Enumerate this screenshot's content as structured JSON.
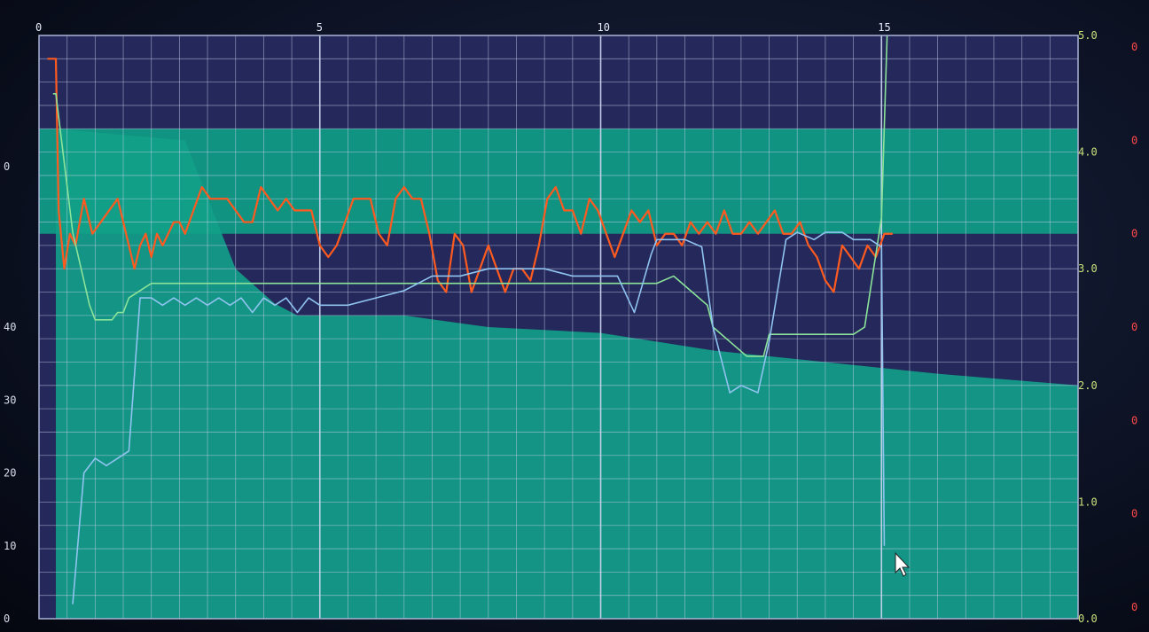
{
  "colors": {
    "plot_bg": "#25285a",
    "band": "#0f9a84",
    "envelope": "#12a088",
    "grid": "#c9d3ee",
    "red_line": "#ff5a1f",
    "green_line": "#8be39a",
    "blue_line": "#8fc3f0",
    "left_tick": "#d7dcea",
    "right_tick": "#c9e27a",
    "far_right_tick": "#ff4a4a",
    "top_tick": "#e6ecf7"
  },
  "chart_data": {
    "type": "line",
    "title": "",
    "xlabel": "",
    "ylabel": "",
    "grid": true,
    "x_ticks": [
      "0",
      "5",
      "10",
      "15"
    ],
    "xlim": [
      0,
      18.5
    ],
    "left_axis": {
      "ylim": [
        0,
        80
      ],
      "ticks": [
        "0",
        "10",
        "20",
        "30",
        "40",
        "0"
      ]
    },
    "right_axis": {
      "ylim": [
        0,
        5
      ],
      "ticks": [
        "0.0",
        "1.0",
        "2.0",
        "3.0",
        "4.0",
        "5.0"
      ]
    },
    "far_right_ticks": [
      "0",
      "0",
      "0",
      "0",
      "0",
      "0",
      "0"
    ],
    "band": {
      "axis": "right",
      "y_from": 3.3,
      "y_to": 4.2,
      "x_from": 0,
      "x_to": 18.5
    },
    "envelope": {
      "axis": "right",
      "x": [
        0.3,
        2.6,
        3.5,
        4.2,
        4.6,
        5.3,
        6.5,
        8,
        10,
        12,
        14,
        16,
        18.5
      ],
      "y": [
        4.2,
        4.1,
        3.0,
        2.7,
        2.6,
        2.6,
        2.6,
        2.5,
        2.45,
        2.3,
        2.2,
        2.1,
        2.0
      ]
    },
    "series": [
      {
        "axis": "right",
        "x": [
          0.15,
          0.3,
          0.35,
          0.45,
          0.55,
          0.65,
          0.8,
          0.95,
          1.1,
          1.25,
          1.4,
          1.55,
          1.7,
          1.8,
          1.9,
          2.0,
          2.1,
          2.2,
          2.3,
          2.4,
          2.5,
          2.6,
          2.75,
          2.9,
          3.05,
          3.2,
          3.35,
          3.5,
          3.65,
          3.8,
          3.95,
          4.1,
          4.25,
          4.4,
          4.55,
          4.7,
          4.85,
          5.0,
          5.15,
          5.3,
          5.45,
          5.6,
          5.75,
          5.9,
          6.05,
          6.2,
          6.35,
          6.5,
          6.65,
          6.8,
          6.95,
          7.1,
          7.25,
          7.4,
          7.55,
          7.7,
          7.85,
          8.0,
          8.15,
          8.3,
          8.45,
          8.6,
          8.75,
          8.9,
          9.05,
          9.2,
          9.35,
          9.5,
          9.65,
          9.8,
          9.95,
          10.1,
          10.25,
          10.4,
          10.55,
          10.7,
          10.85,
          11.0,
          11.15,
          11.3,
          11.45,
          11.6,
          11.75,
          11.9,
          12.05,
          12.2,
          12.35,
          12.5,
          12.65,
          12.8,
          12.95,
          13.1,
          13.25,
          13.4,
          13.55,
          13.7,
          13.85,
          14.0,
          14.15,
          14.3,
          14.45,
          14.6,
          14.75,
          14.9,
          15.05,
          15.2
        ],
        "y": [
          4.8,
          4.8,
          3.5,
          3.0,
          3.3,
          3.2,
          3.6,
          3.3,
          3.4,
          3.5,
          3.6,
          3.3,
          3.0,
          3.2,
          3.3,
          3.1,
          3.3,
          3.2,
          3.3,
          3.4,
          3.4,
          3.3,
          3.5,
          3.7,
          3.6,
          3.6,
          3.6,
          3.5,
          3.4,
          3.4,
          3.7,
          3.6,
          3.5,
          3.6,
          3.5,
          3.5,
          3.5,
          3.2,
          3.1,
          3.2,
          3.4,
          3.6,
          3.6,
          3.6,
          3.3,
          3.2,
          3.6,
          3.7,
          3.6,
          3.6,
          3.3,
          2.9,
          2.8,
          3.3,
          3.2,
          2.8,
          3.0,
          3.2,
          3.0,
          2.8,
          3.0,
          3.0,
          2.9,
          3.2,
          3.6,
          3.7,
          3.5,
          3.5,
          3.3,
          3.6,
          3.5,
          3.3,
          3.1,
          3.3,
          3.5,
          3.4,
          3.5,
          3.2,
          3.3,
          3.3,
          3.2,
          3.4,
          3.3,
          3.4,
          3.3,
          3.5,
          3.3,
          3.3,
          3.4,
          3.3,
          3.4,
          3.5,
          3.3,
          3.3,
          3.4,
          3.2,
          3.1,
          2.9,
          2.8,
          3.2,
          3.1,
          3.0,
          3.2,
          3.1,
          3.3,
          3.3
        ]
      },
      {
        "axis": "left",
        "x": [
          0.25,
          0.3,
          0.6,
          0.9,
          1.0,
          1.2,
          1.3,
          1.4,
          1.5,
          1.6,
          2.0,
          2.5,
          3.0,
          3.2,
          3.5,
          4.0,
          5.0,
          6.0,
          7.0,
          8.0,
          9.0,
          9.5,
          10.0,
          10.3,
          10.5,
          10.8,
          11.0,
          11.3,
          11.6,
          11.9,
          12.0,
          12.3,
          12.6,
          12.9,
          13.0,
          13.5,
          14.0,
          14.3,
          14.5,
          14.7,
          15.0,
          15.1
        ],
        "y": [
          72,
          72,
          53,
          43,
          41,
          41,
          41,
          42,
          42,
          44,
          46,
          46,
          46,
          46,
          46,
          46,
          46,
          46,
          46,
          46,
          46,
          46,
          46,
          46,
          46,
          46,
          46,
          47,
          45,
          43,
          40,
          38,
          36,
          36,
          39,
          39,
          39,
          39,
          39,
          40,
          55,
          80
        ]
      },
      {
        "axis": "left",
        "x": [
          0.6,
          0.8,
          1.0,
          1.2,
          1.4,
          1.6,
          1.8,
          2.0,
          2.2,
          2.4,
          2.6,
          2.8,
          3.0,
          3.2,
          3.4,
          3.6,
          3.8,
          4.0,
          4.2,
          4.4,
          4.6,
          4.8,
          5.0,
          5.5,
          6.0,
          6.5,
          7.0,
          7.5,
          8.0,
          8.5,
          9.0,
          9.5,
          10.0,
          10.3,
          10.6,
          10.9,
          11.0,
          11.2,
          11.5,
          11.8,
          12.0,
          12.3,
          12.5,
          12.8,
          13.0,
          13.3,
          13.5,
          13.8,
          14.0,
          14.3,
          14.5,
          14.8,
          15.0,
          15.05
        ],
        "y": [
          2,
          20,
          22,
          21,
          22,
          23,
          44,
          44,
          43,
          44,
          43,
          44,
          43,
          44,
          43,
          44,
          42,
          44,
          43,
          44,
          42,
          44,
          43,
          43,
          44,
          45,
          47,
          47,
          48,
          48,
          48,
          47,
          47,
          47,
          42,
          50,
          52,
          52,
          52,
          51,
          40,
          31,
          32,
          31,
          38,
          52,
          53,
          52,
          53,
          53,
          52,
          52,
          51,
          10
        ]
      }
    ]
  }
}
